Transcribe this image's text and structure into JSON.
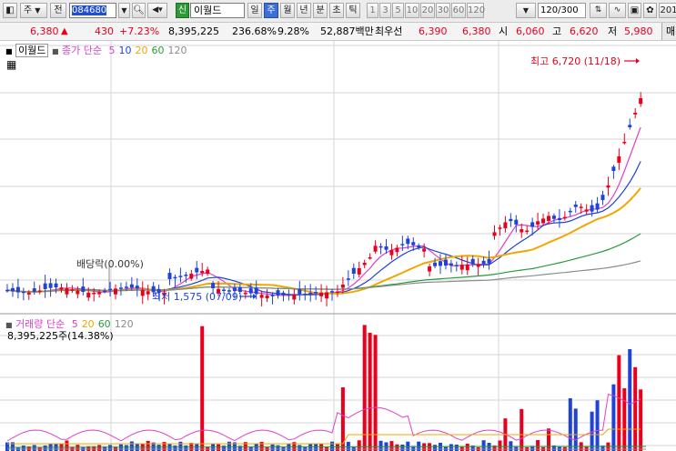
{
  "toolbar": {
    "market_label": "주",
    "prefix_label": "전",
    "stock_code": "084680",
    "badge_label": "신",
    "stock_name": "이월드",
    "period_tabs": [
      "일",
      "주",
      "월",
      "년",
      "분",
      "초",
      "틱"
    ],
    "selected_period": "주",
    "interval_buttons": [
      "1",
      "3",
      "5",
      "10",
      "20",
      "30",
      "60",
      "120"
    ],
    "view_count": "120",
    "view_total": "/300",
    "right_cut_text": "201"
  },
  "quote": {
    "price": "6,380",
    "change_arrow": "▲",
    "change": "430",
    "change_pct": "+7.23%",
    "volume": "8,395,225",
    "volume_ratio": "236.68%",
    "turnover": "9.28%",
    "amount": "52,887백만",
    "best_bid_label": "최우선",
    "best_ask": "6,390",
    "best_bid": "6,380",
    "open_label": "시",
    "open": "6,060",
    "high_label": "고",
    "high": "6,620",
    "low_label": "저",
    "low": "5,980",
    "right_cut_text": "매"
  },
  "price_panel": {
    "name_label": "이월드",
    "ma_label": "종가 단순",
    "ma_periods": [
      "5",
      "10",
      "20",
      "60",
      "120"
    ],
    "ma_colors": [
      "#e040c8",
      "#1f43d6",
      "#f0a800",
      "#2a9b3c",
      "#8c8c8c"
    ],
    "high_annotation": "최고 6,720 (11/18)",
    "low_annotation": "최저 1,575 (07/09)",
    "dividend_annotation": "배당락(0.00%)"
  },
  "volume_panel": {
    "name_label": "거래량",
    "ma_label": "단순",
    "ma_periods": [
      "5",
      "20",
      "60",
      "120"
    ],
    "ma_colors": [
      "#e040c8",
      "#f0a800",
      "#2a9b3c",
      "#8c8c8c"
    ],
    "current_volume": "8,395,225주(14.38%)"
  },
  "colors": {
    "up": "#e8001c",
    "down": "#1f43d6",
    "grid": "#d6d6d6"
  }
}
